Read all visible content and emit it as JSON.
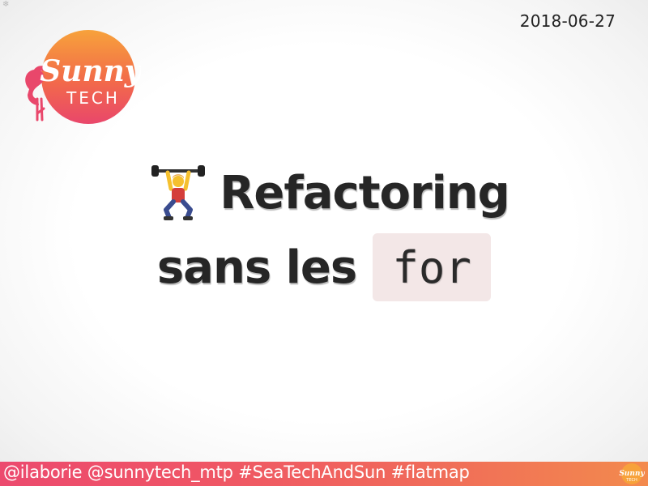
{
  "date": "2018-06-27",
  "logo": {
    "icon": "sunny-tech-flamingo-logo",
    "text_top": "Sunny",
    "text_bottom": "TECH"
  },
  "title": {
    "emoji_icon": "weightlifter-emoji",
    "line1": "Refactoring",
    "line2_prefix": "sans les",
    "code": "for"
  },
  "footer": {
    "text": "@ilaborie @sunnytech_mtp #SeaTechAndSun #flatmap",
    "icon": "sunny-tech-small-logo"
  },
  "colors": {
    "footer_start": "#ec4a6e",
    "footer_end": "#f38a4d",
    "code_background": "#f3e7e7"
  }
}
